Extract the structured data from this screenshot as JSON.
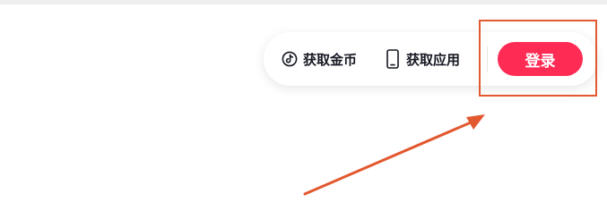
{
  "header": {
    "nav": [
      {
        "label": "获取金币",
        "icon": "tiktok-note-icon"
      },
      {
        "label": "获取应用",
        "icon": "mobile-phone-icon"
      }
    ],
    "login_label": "登录"
  },
  "colors": {
    "login_button": "#fe2c55",
    "nav_text": "#161823",
    "annotation": "#e2582f"
  }
}
